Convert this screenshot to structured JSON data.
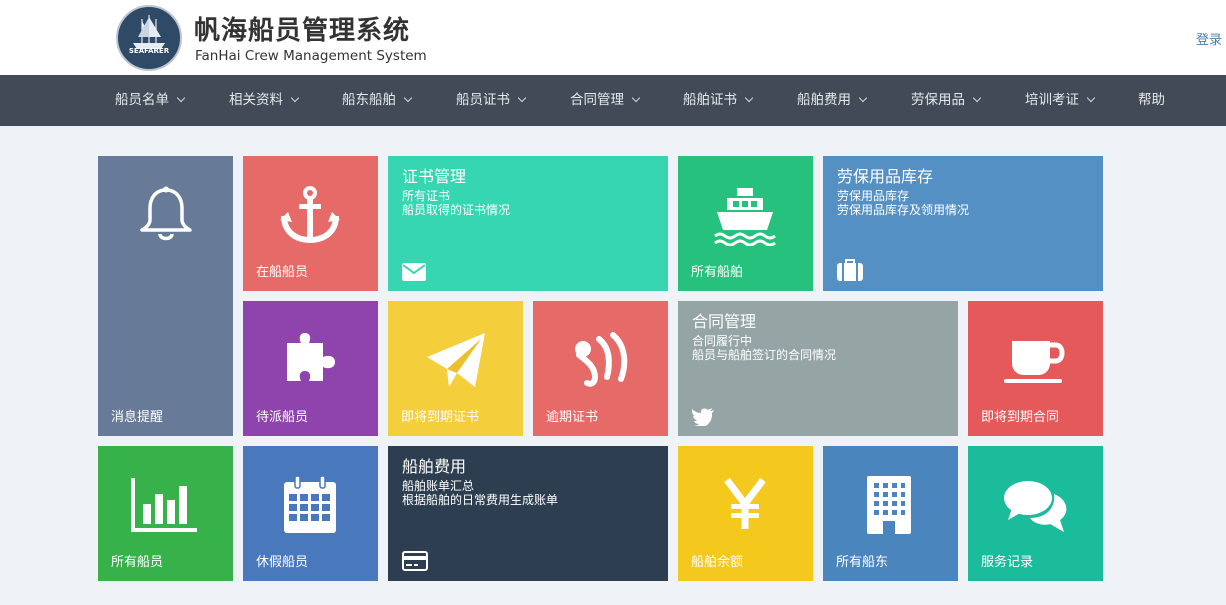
{
  "header": {
    "logo_text": "SEAFARER",
    "brand_cn": "帆海船员管理系统",
    "brand_en": "FanHai Crew Management System",
    "login_label": "登录"
  },
  "nav": {
    "items": [
      {
        "label": "船员名单"
      },
      {
        "label": "相关资料"
      },
      {
        "label": "船东船舶"
      },
      {
        "label": "船员证书"
      },
      {
        "label": "合同管理"
      },
      {
        "label": "船舶证书"
      },
      {
        "label": "船舶费用"
      },
      {
        "label": "劳保用品"
      },
      {
        "label": "培训考证"
      },
      {
        "label": "帮助"
      }
    ]
  },
  "tiles": {
    "messages": {
      "label": "消息提醒",
      "icon": "bell-icon",
      "color": "#677b98"
    },
    "onboard": {
      "label": "在船船员",
      "icon": "anchor-icon",
      "color": "#e56a68"
    },
    "cert_mgmt": {
      "title": "证书管理",
      "line1": "所有证书",
      "line2": "船员取得的证书情况",
      "icon": "envelope-icon",
      "color": "#37d6b3"
    },
    "all_ships": {
      "label": "所有船舶",
      "icon": "ship-icon",
      "color": "#26c17c"
    },
    "ppe_stock": {
      "title": "劳保用品库存",
      "line1": "劳保用品库存",
      "line2": "劳保用品库存及领用情况",
      "icon": "briefcase-icon",
      "color": "#5490c4"
    },
    "pending": {
      "label": "待派船员",
      "icon": "puzzle-icon",
      "color": "#8f44ad"
    },
    "expiring_certs": {
      "label": "即将到期证书",
      "icon": "paper-plane-icon",
      "color": "#f4cf3b"
    },
    "overdue_certs": {
      "label": "逾期证书",
      "icon": "signal-icon",
      "color": "#e56a68"
    },
    "contract_mgmt": {
      "title": "合同管理",
      "line1": "合同履行中",
      "line2": "船员与船舶签订的合同情况",
      "icon": "twitter-icon",
      "color": "#95a5a6"
    },
    "expiring_contracts": {
      "label": "即将到期合同",
      "icon": "coffee-cup-icon",
      "color": "#e6595b"
    },
    "all_crew": {
      "label": "所有船员",
      "icon": "bar-chart-icon",
      "color": "#37b24a"
    },
    "on_leave": {
      "label": "休假船员",
      "icon": "calendar-icon",
      "color": "#4a78bd"
    },
    "ship_fees": {
      "title": "船舶费用",
      "line1": "船舶账单汇总",
      "line2": "根据船舶的日常费用生成账单",
      "icon": "credit-card-icon",
      "color": "#2c3e50"
    },
    "balance": {
      "label": "船舶余额",
      "icon": "yen-icon",
      "color": "#f4c81c"
    },
    "owners": {
      "label": "所有船东",
      "icon": "building-icon",
      "color": "#4a86bd"
    },
    "service": {
      "label": "服务记录",
      "icon": "comments-icon",
      "color": "#1abc9c"
    }
  }
}
